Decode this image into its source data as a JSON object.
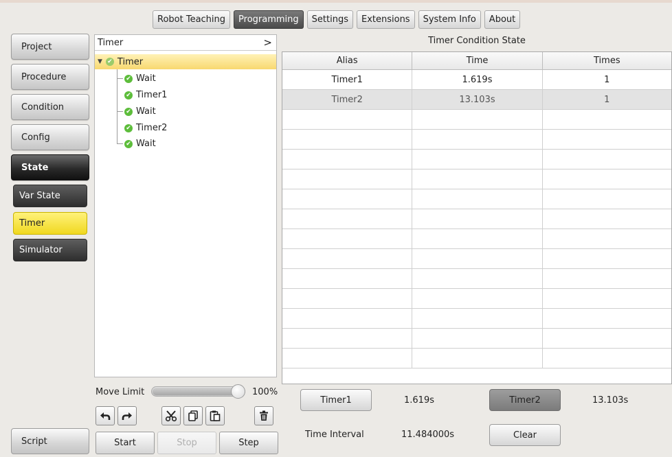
{
  "tabs": [
    "Robot Teaching",
    "Programming",
    "Settings",
    "Extensions",
    "System Info",
    "About"
  ],
  "active_tab": "Programming",
  "sidebar": {
    "items": [
      "Project",
      "Procedure",
      "Condition",
      "Config",
      "State"
    ],
    "sub_items": [
      "Var State",
      "Timer",
      "Simulator"
    ],
    "script": "Script"
  },
  "tree": {
    "header": "Timer",
    "expand_glyph": ">",
    "nodes": [
      "Timer",
      "Wait",
      "Timer1",
      "Wait",
      "Timer2",
      "Wait"
    ]
  },
  "move_limit": {
    "label": "Move Limit",
    "value_text": "100%",
    "fraction": 0.93
  },
  "toolbar_icons": [
    "undo-icon",
    "redo-icon",
    "cut-icon",
    "copy-icon",
    "paste-icon",
    "delete-icon"
  ],
  "controls": {
    "start": "Start",
    "stop": "Stop",
    "step": "Step"
  },
  "table": {
    "title": "Timer Condition State",
    "headers": [
      "Alias",
      "Time",
      "Times"
    ],
    "rows": [
      [
        "Timer1",
        "1.619s",
        "1"
      ],
      [
        "Timer2",
        "13.103s",
        "1"
      ]
    ]
  },
  "bottom": {
    "timer1_label": "Timer1",
    "timer1_time": "1.619s",
    "timer2_label": "Timer2",
    "timer2_time": "13.103s",
    "interval_label": "Time Interval",
    "interval_value": "11.484000s",
    "clear": "Clear"
  },
  "colors": {
    "active_yellow": "#f5df2e",
    "check_green": "#5dbd3b",
    "dark_button": "#2e2e2e"
  }
}
